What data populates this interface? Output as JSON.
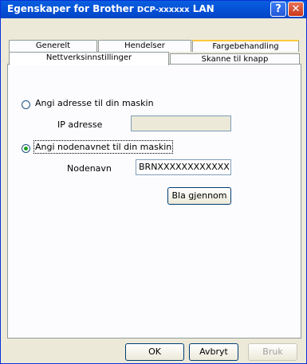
{
  "window": {
    "title": "Egenskaper for Brother",
    "model": "DCP-xxxxxx",
    "suffix": "LAN",
    "help_icon": "?",
    "close_icon": "✕"
  },
  "tabs": {
    "row1": [
      "Generelt",
      "Hendelser",
      "Fargebehandling"
    ],
    "row2": [
      "Nettverksinnstillinger",
      "Skanne til knapp"
    ],
    "active": "Nettverksinnstillinger"
  },
  "panel": {
    "option_ip_label": "Angi adresse til din maskin",
    "ip_label": "IP adresse",
    "ip_value": "",
    "option_node_label": "Angi nodenavnet til din maskin",
    "node_label": "Nodenavn",
    "node_value": "BRNXXXXXXXXXXXX",
    "browse_button": "Bla gjennom",
    "selected_option": "node"
  },
  "footer": {
    "ok": "OK",
    "cancel": "Avbryt",
    "apply": "Bruk"
  },
  "colors": {
    "titlebar": "#0451d6",
    "window_bg": "#ece9d8",
    "panel_bg": "#fcfcfe",
    "tab_highlight": "#ffc83c",
    "radio_dot": "#21a121"
  }
}
